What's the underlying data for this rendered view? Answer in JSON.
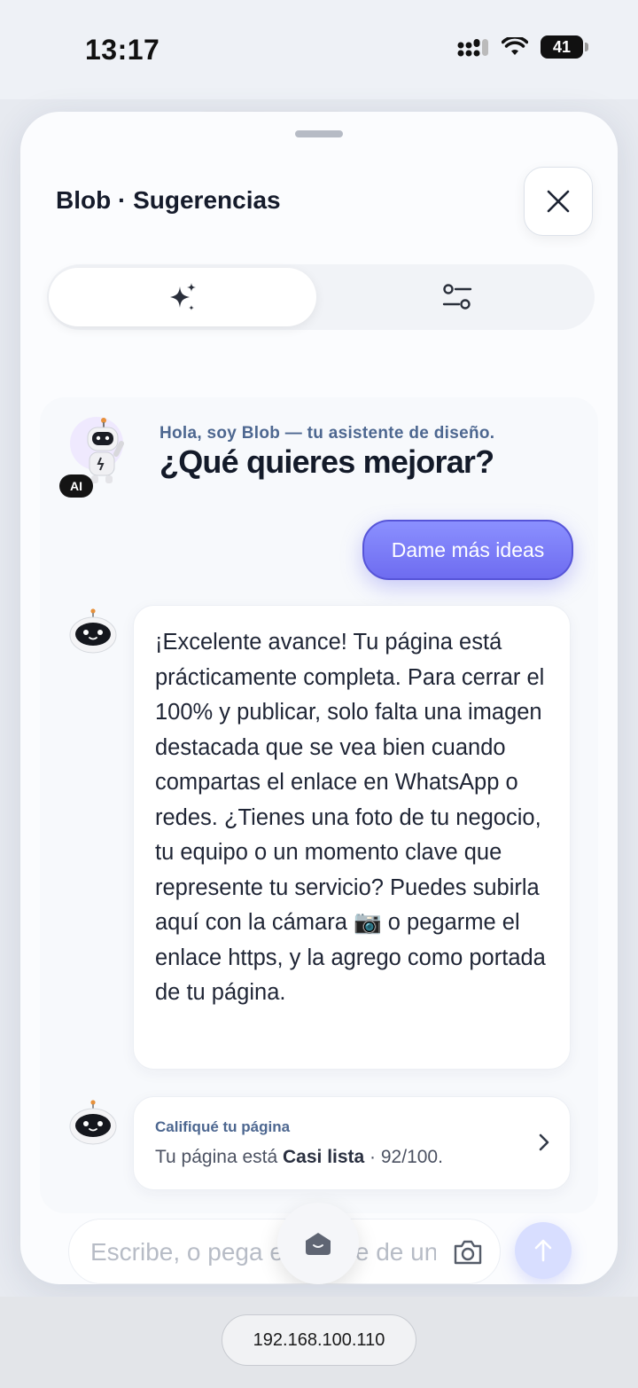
{
  "status_bar": {
    "time": "13:17",
    "battery": "41"
  },
  "sheet": {
    "title": "Blob · Sugerencias",
    "tabs": [
      {
        "icon": "sparkles-icon",
        "active": true
      },
      {
        "icon": "sliders-icon",
        "active": false
      }
    ]
  },
  "chat": {
    "ai_badge": "AI",
    "greeting": "Hola, soy Blob — tu asistente de diseño.",
    "question": "¿Qué quieres mejorar?",
    "user_reply": "Dame más ideas",
    "bot_message": "¡Excelente avance! Tu página está prácticamente completa. Para cerrar el 100% y publicar, solo falta una imagen destacada que se vea bien cuando compartas el enlace en WhatsApp o redes. ¿Tienes una foto de tu negocio, tu equipo o un momento clave que represente tu servicio? Puedes subirla aquí con la cámara 📷 o pegarme el enlace https, y la agrego como portada de tu página.",
    "rating_card": {
      "title": "Califiqué tu página",
      "prefix": "Tu página está ",
      "status": "Casi lista",
      "score": " · 92/100."
    }
  },
  "composer": {
    "placeholder": "Escribe, o pega el enlace de una imagen"
  },
  "browser": {
    "url": "192.168.100.110"
  },
  "colors": {
    "accent": "#6e6cf0",
    "label_blue": "#4d6790"
  }
}
